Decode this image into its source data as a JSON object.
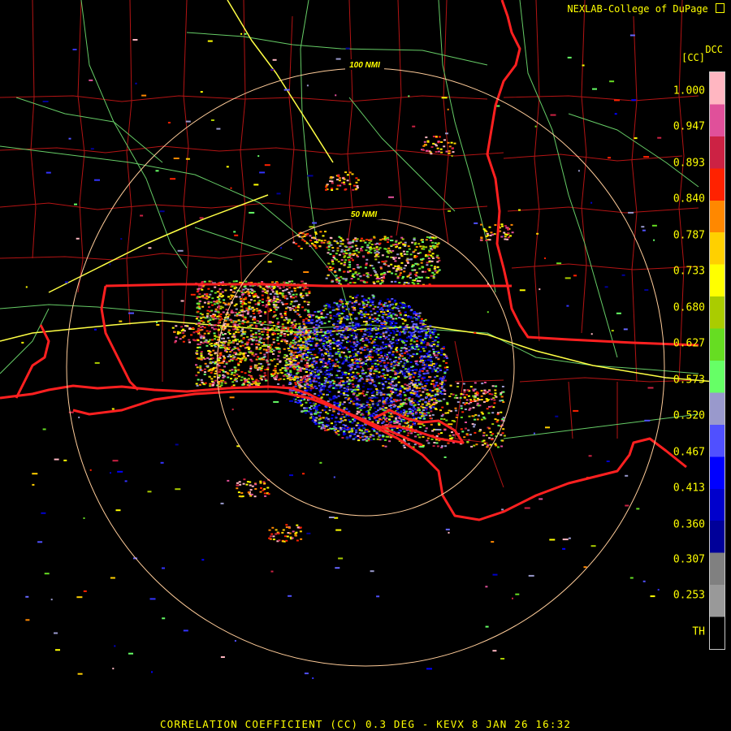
{
  "header": {
    "credit": "NEXLAB-College of DuPage",
    "credit_icon": "cod-logo-icon"
  },
  "legend": {
    "tag": "DCC",
    "unit": "[CC]",
    "ticks": [
      "1.000",
      "0.947",
      "0.893",
      "0.840",
      "0.787",
      "0.733",
      "0.680",
      "0.627",
      "0.573",
      "0.520",
      "0.467",
      "0.413",
      "0.360",
      "0.307",
      "0.253",
      "TH"
    ],
    "colors": [
      "#ffb6c1",
      "#e0509a",
      "#cc2244",
      "#ff2200",
      "#ff8800",
      "#ffd000",
      "#ffff00",
      "#aacc00",
      "#66dd22",
      "#66ff66",
      "#9999cc",
      "#5050ff",
      "#0000ff",
      "#0000cc",
      "#000099",
      "#808080",
      "#999999",
      "#000000"
    ]
  },
  "range_rings": {
    "inner": "50 NMI",
    "outer": "100 NMI"
  },
  "map_colors": {
    "state_border": "#ff2020",
    "county_border": "#b41414",
    "highway": "#66cc66",
    "interstate": "#ffff44",
    "ring": "#ffcc99"
  },
  "footer": {
    "title": "CORRELATION COEFFICIENT (CC) 0.3 DEG - KEVX 8 JAN 26 16:32"
  }
}
